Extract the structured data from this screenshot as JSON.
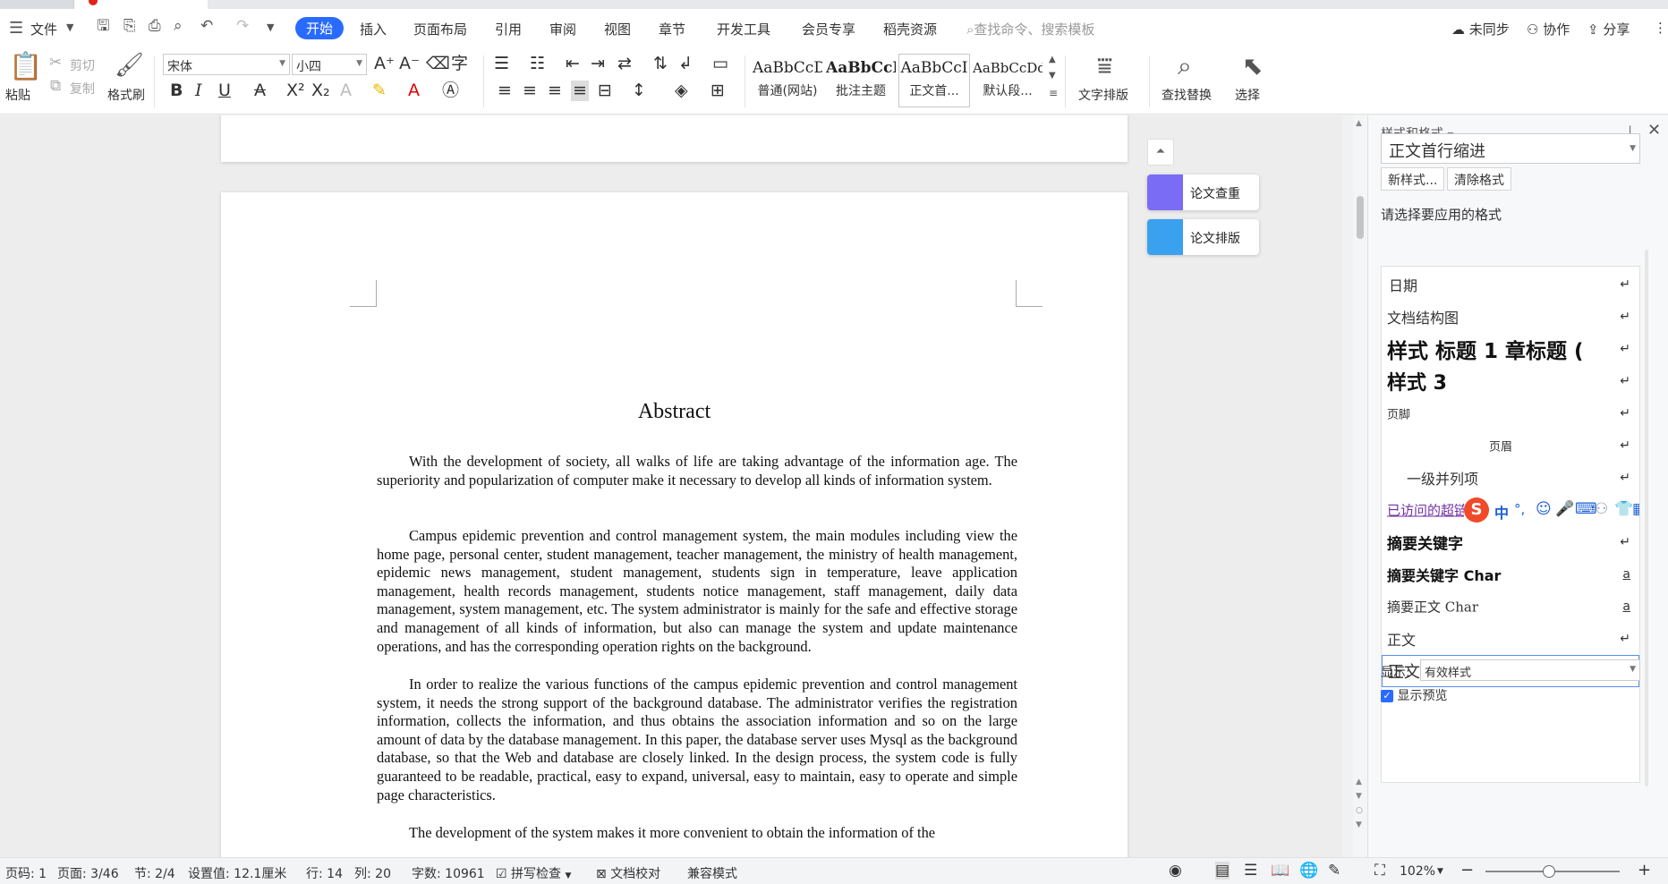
{
  "menubar": {
    "file_label": "文件",
    "tabs": [
      "开始",
      "插入",
      "页面布局",
      "引用",
      "审阅",
      "视图",
      "章节",
      "开发工具",
      "会员专享",
      "稻壳资源"
    ],
    "search_placeholder": "查找命令、搜索模板",
    "sync_label": "未同步",
    "collab_label": "协作",
    "share_label": "分享"
  },
  "ribbon": {
    "paste": "粘贴",
    "cut": "剪切",
    "copy": "复制",
    "format_painter": "格式刷",
    "font_name": "宋体",
    "font_size": "小四",
    "styles": [
      {
        "preview": "AaBbCcDc",
        "name": "普通(网站)"
      },
      {
        "preview": "AaBbCcD",
        "name": "批注主题"
      },
      {
        "preview": "AaBbCcI",
        "name": "正文首..."
      },
      {
        "preview": "AaBbCcDd",
        "name": "默认段..."
      }
    ],
    "text_layout": "文字排版",
    "find_replace": "查找替换",
    "select": "选择"
  },
  "document": {
    "title": "Abstract",
    "paragraphs": [
      "With the development of society, all walks of life are taking advantage of the information age. The superiority and popularization of computer make it necessary to develop all kinds of information system.",
      "Campus epidemic prevention and control management system, the main modules including view the home page, personal center, student management, teacher management, the ministry of health management, epidemic news management, student management, students sign in temperature, leave application management, health records management, students notice management, staff management, daily data management, system management, etc. The system administrator is mainly for the safe and effective storage and management of all kinds of information, but also can manage the system and update maintenance operations, and has the corresponding operation rights on the background.",
      "In order to realize the various functions of the campus epidemic prevention and control management system, it needs the strong support of the background database. The administrator verifies the registration information, collects the information, and thus obtains the association information and so on the large amount of data by the database management. In this paper, the database server uses Mysql as the background database, so that the Web and database are closely linked. In the design process, the system code is fully guaranteed to be readable, practical, easy to expand, universal, easy to maintain, easy to operate and simple page characteristics.",
      "The development of the system makes it more convenient to obtain the information of the"
    ]
  },
  "float_tools": {
    "paper_check": "论文查重",
    "paper_layout": "论文排版"
  },
  "panel": {
    "title": "样式和格式",
    "current_style": "正文首行缩进",
    "new_style": "新样式...",
    "clear_format": "清除格式",
    "choose_label": "请选择要应用的格式",
    "styles": [
      {
        "name": "日期",
        "mark": "↵"
      },
      {
        "name": "文档结构图",
        "mark": "↵"
      },
      {
        "name": "样式 标题 1 章标题 (",
        "mark": "↵"
      },
      {
        "name": "样式 3",
        "mark": "↵"
      },
      {
        "name": "页脚",
        "mark": "↵"
      },
      {
        "name": "页眉",
        "mark": "↵"
      },
      {
        "name": "一级并列项",
        "mark": "↵"
      },
      {
        "name": "已访问的超链接",
        "mark": ""
      },
      {
        "name": "摘要关键字",
        "mark": "↵"
      },
      {
        "name": "摘要关键字 Char",
        "mark": "a"
      },
      {
        "name": "摘要正文 Char",
        "mark": "a"
      },
      {
        "name": "正文",
        "mark": "↵"
      },
      {
        "name": "正文首行缩进",
        "mark": "↵"
      }
    ],
    "show_label": "显示:",
    "show_value": "有效样式",
    "preview_label": "显示预览"
  },
  "ime": {
    "mode": "中",
    "punct": "°,"
  },
  "statusbar": {
    "page_code": "页码: 1",
    "page": "页面: 3/46",
    "section": "节: 2/4",
    "setting": "设置值: 12.1厘米",
    "row": "行: 14",
    "col": "列: 20",
    "word_count": "字数: 10961",
    "spell_check": "拼写检查",
    "doc_proof": "文档校对",
    "compat": "兼容模式",
    "zoom": "102%",
    "zoom_level": 0.47
  },
  "colors": {
    "accent": "#2a6bff",
    "paper_check_icon": "#7b6cf6",
    "paper_layout_icon": "#3aa0f0",
    "sogou": "#f04a2a"
  }
}
